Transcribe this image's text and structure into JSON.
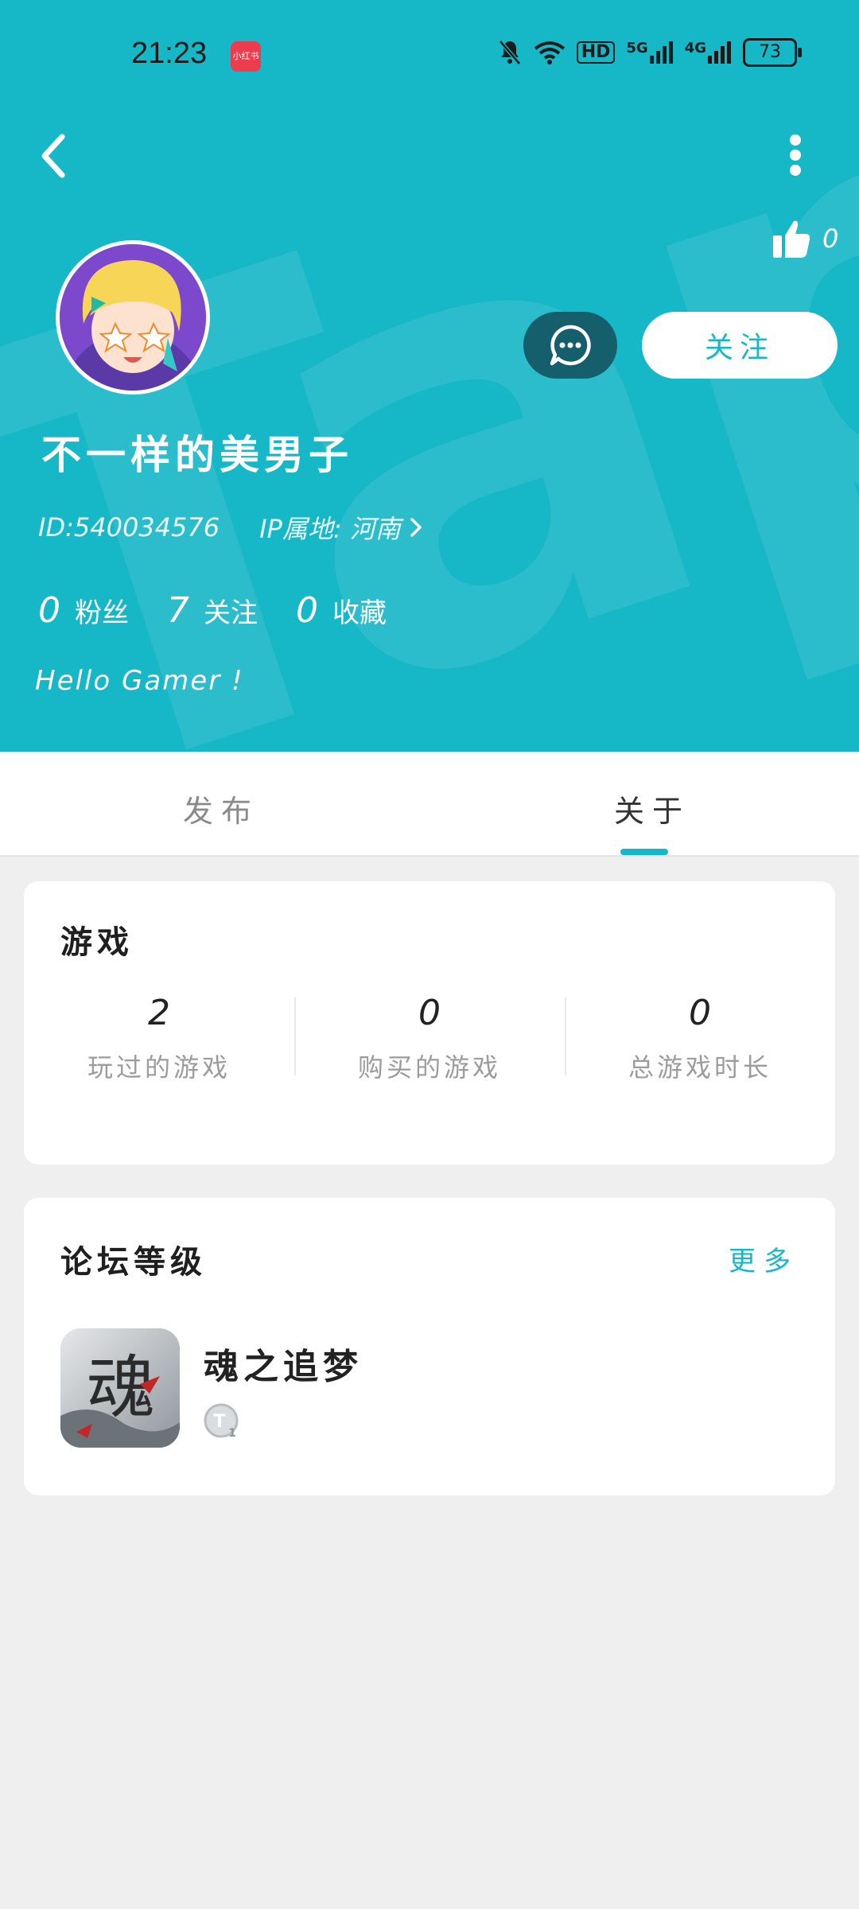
{
  "status_bar": {
    "time": "21:23",
    "app_badge": "小红书",
    "network_hd": "HD",
    "network_5g": "5G",
    "network_4g": "4G",
    "battery": "73"
  },
  "profile": {
    "like_count": "0",
    "follow_button": "关注",
    "username": "不一样的美男子",
    "id_text": "ID:540034576",
    "ip_text": "IP属地: 河南",
    "stats": [
      {
        "num": "0",
        "label": "粉丝"
      },
      {
        "num": "7",
        "label": "关注"
      },
      {
        "num": "0",
        "label": "收藏"
      }
    ],
    "bio": "Hello Gamer !"
  },
  "tabs": [
    {
      "label": "发布"
    },
    {
      "label": "关于"
    }
  ],
  "games_card": {
    "title": "游戏",
    "stats": [
      {
        "num": "2",
        "label": "玩过的游戏"
      },
      {
        "num": "0",
        "label": "购买的游戏"
      },
      {
        "num": "0",
        "label": "总游戏时长"
      }
    ]
  },
  "forum_card": {
    "title": "论坛等级",
    "more": "更多",
    "forum_name": "魂之追梦",
    "icon_text": "魂"
  },
  "colors": {
    "accent": "#16b7c6",
    "message_button": "#155f6c",
    "background": "#efefef"
  }
}
